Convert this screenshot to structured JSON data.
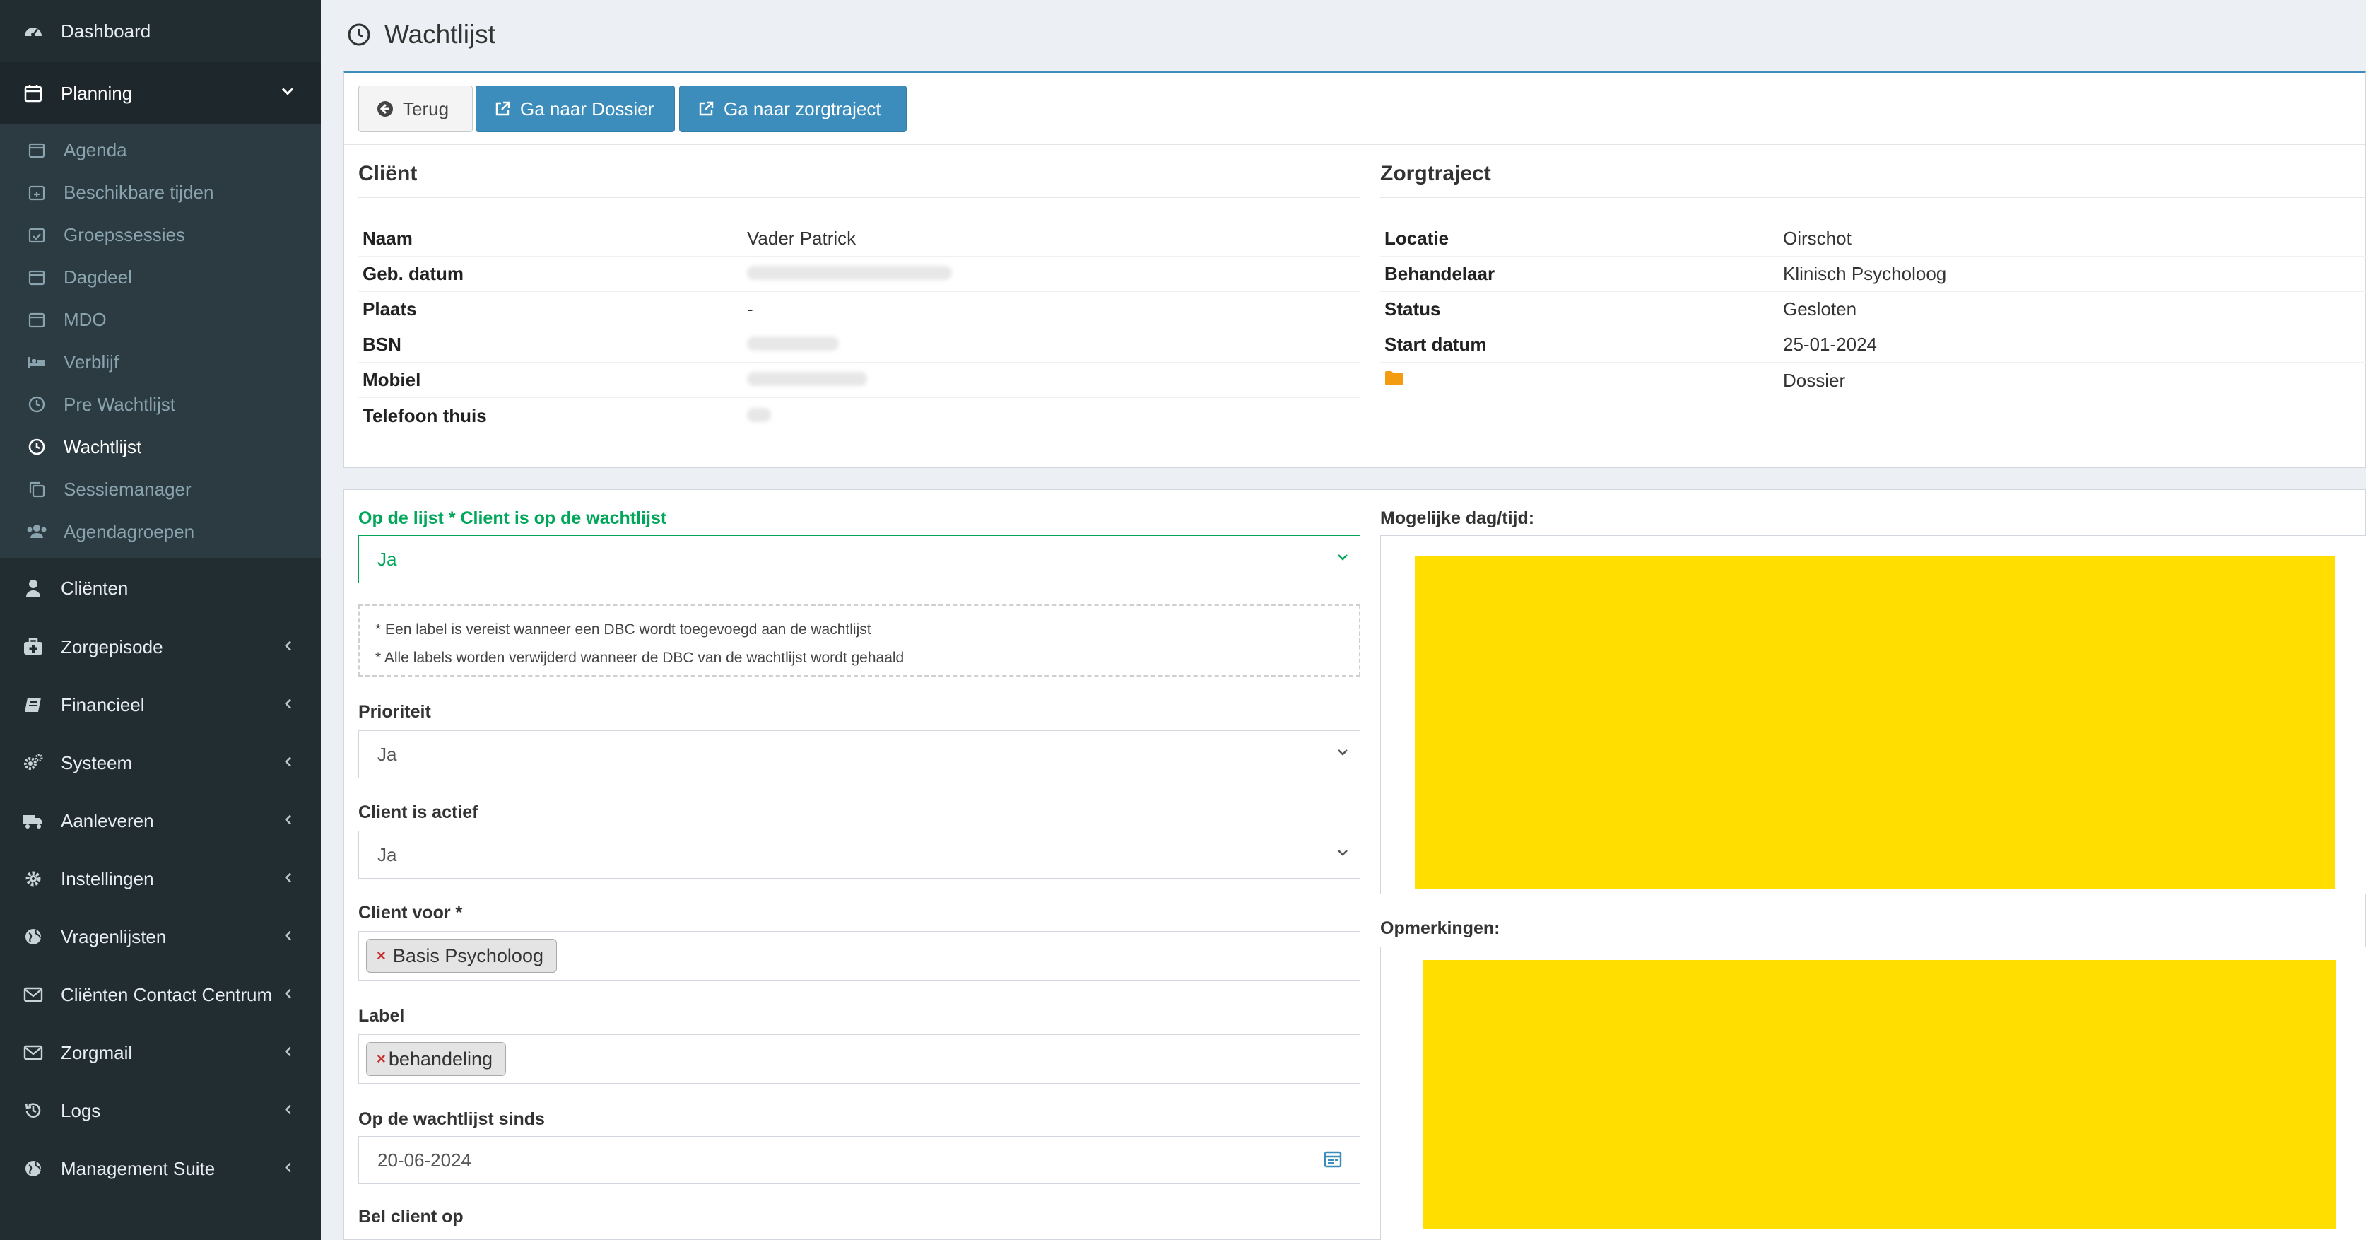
{
  "sidebar": {
    "top_items": [
      {
        "label": "Dashboard",
        "icon": "dashboard-icon"
      }
    ],
    "planning": {
      "label": "Planning",
      "icon": "calendar-icon"
    },
    "planning_items": [
      {
        "label": "Agenda",
        "icon": "calendar-icon"
      },
      {
        "label": "Beschikbare tijden",
        "icon": "calendar-plus-icon"
      },
      {
        "label": "Groepssessies",
        "icon": "calendar-check-icon"
      },
      {
        "label": "Dagdeel",
        "icon": "calendar-icon"
      },
      {
        "label": "MDO",
        "icon": "calendar-icon"
      },
      {
        "label": "Verblijf",
        "icon": "bed-icon"
      },
      {
        "label": "Pre Wachtlijst",
        "icon": "clock-icon"
      },
      {
        "label": "Wachtlijst",
        "icon": "clock-icon"
      },
      {
        "label": "Sessiemanager",
        "icon": "copy-icon"
      },
      {
        "label": "Agendagroepen",
        "icon": "users-icon"
      }
    ],
    "other_items": [
      {
        "label": "Cliënten",
        "icon": "user-icon",
        "chev": false
      },
      {
        "label": "Zorgepisode",
        "icon": "medkit-icon",
        "chev": true
      },
      {
        "label": "Financieel",
        "icon": "book-icon",
        "chev": true
      },
      {
        "label": "Systeem",
        "icon": "cogs-icon",
        "chev": true
      },
      {
        "label": "Aanleveren",
        "icon": "truck-icon",
        "chev": true
      },
      {
        "label": "Instellingen",
        "icon": "gear-icon",
        "chev": true
      },
      {
        "label": "Vragenlijsten",
        "icon": "globe-icon",
        "chev": true
      },
      {
        "label": "Cliënten Contact Centrum",
        "icon": "envelope-icon",
        "chev": true
      },
      {
        "label": "Zorgmail",
        "icon": "envelope-icon",
        "chev": true
      },
      {
        "label": "Logs",
        "icon": "history-icon",
        "chev": true
      },
      {
        "label": "Management Suite",
        "icon": "globe-icon",
        "chev": true
      }
    ]
  },
  "page": {
    "title": "Wachtlijst"
  },
  "toolbar": {
    "back_label": "Terug",
    "dossier_label": "Ga naar Dossier",
    "zorgtraject_label": "Ga naar zorgtraject"
  },
  "client": {
    "heading": "Cliënt",
    "rows": [
      {
        "key": "Naam",
        "value": "Vader Patrick"
      },
      {
        "key": "Geb. datum",
        "value": ""
      },
      {
        "key": "Plaats",
        "value": "-"
      },
      {
        "key": "BSN",
        "value": ""
      },
      {
        "key": "Mobiel",
        "value": ""
      },
      {
        "key": "Telefoon thuis",
        "value": ""
      }
    ]
  },
  "zorgtraject": {
    "heading": "Zorgtraject",
    "rows": [
      {
        "key": "Locatie",
        "value": "Oirschot"
      },
      {
        "key": "Behandelaar",
        "value": "Klinisch Psycholoog"
      },
      {
        "key": "Status",
        "value": "Gesloten"
      },
      {
        "key": "Start datum",
        "value": "25-01-2024"
      }
    ],
    "dossier_link": "Dossier"
  },
  "form": {
    "op_de_lijst_label": "Op de lijst * Client is op de wachtlijst",
    "op_de_lijst_value": "Ja",
    "notes": [
      "* Een label is vereist wanneer een DBC wordt toegevoegd aan de wachtlijst",
      "* Alle labels worden verwijderd wanneer de DBC van de wachtlijst wordt gehaald"
    ],
    "prioriteit_label": "Prioriteit",
    "prioriteit_value": "Ja",
    "actief_label": "Client is actief",
    "actief_value": "Ja",
    "client_voor_label": "Client voor *",
    "client_voor_tag": "Basis Psycholoog",
    "label_label": "Label",
    "label_tag": "behandeling",
    "sinds_label": "Op de wachtlijst sinds",
    "sinds_value": "20-06-2024",
    "bel_label": "Bel client op",
    "dagtijd_label": "Mogelijke dag/tijd:",
    "opmerkingen_label": "Opmerkingen:"
  },
  "colors": {
    "sidebar": "#222d32",
    "primary": "#3c8dbc",
    "success": "#00a65a",
    "highlight": "#ffde00"
  }
}
